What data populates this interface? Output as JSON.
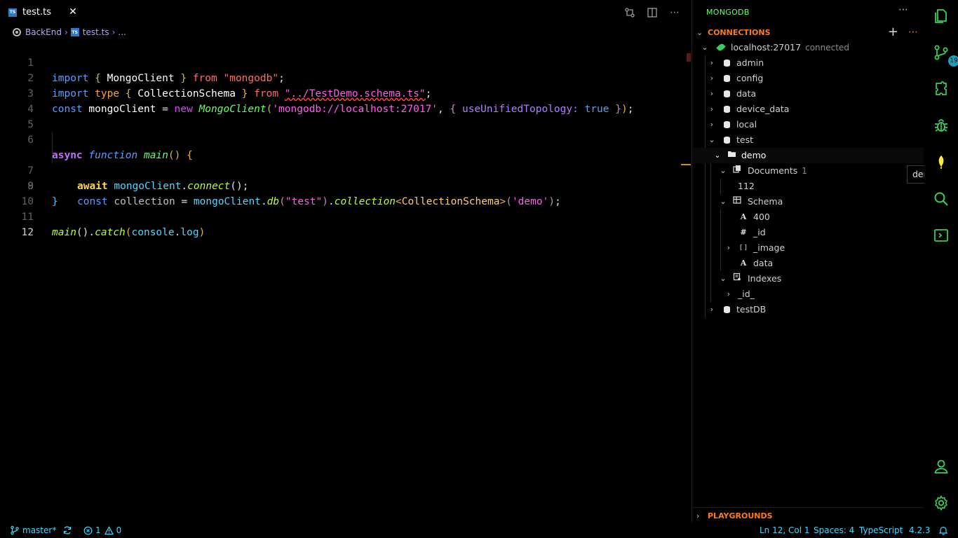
{
  "editor": {
    "tab": {
      "title": "test.ts",
      "icon": "typescript-file-icon"
    },
    "breadcrumb": {
      "folder": "BackEnd",
      "file": "test.ts",
      "more": "..."
    },
    "lines": [
      "1",
      "2",
      "3",
      "4",
      "5",
      "6",
      "7",
      "8",
      "9",
      "10",
      "11",
      "12"
    ],
    "code": {
      "l1": {
        "import": "import",
        "open": "{",
        "name": "MongoClient",
        "close": "}",
        "from": "from",
        "module": "\"mongodb\"",
        "semi": ";"
      },
      "l2": {
        "import": "import",
        "type": "type",
        "open": "{",
        "name": "CollectionSchema",
        "close": "}",
        "from": "from",
        "module": "\"../TestDemo.schema.ts\"",
        "semi": ";"
      },
      "l3": {
        "const": "const",
        "var": "mongoClient",
        "eq": "=",
        "new": "new",
        "cls": "MongoClient",
        "p1": "(",
        "url": "'mongodb://localhost:27017'",
        "comma": ",",
        "o1": "{",
        "key": "useUnifiedTopology:",
        "val": "true",
        "o2": "}",
        "p2": ")",
        "semi": ";"
      },
      "l6": {
        "async": "async",
        "function": "function",
        "name": "main",
        "paren": "()",
        "brace": "{"
      },
      "l7": {
        "await": "await",
        "obj": "mongoClient",
        "dot": ".",
        "method": "connect",
        "rest": "();"
      },
      "l8": {
        "const": "const",
        "var": "collection",
        "eq": "=",
        "obj": "mongoClient",
        "dot1": ".",
        "db": "db",
        "p1": "(",
        "arg1": "\"test\"",
        "p2": ")",
        "dot2": ".",
        "coll": "collection",
        "lt": "<",
        "type": "CollectionSchema",
        "gt": ">",
        "p3": "(",
        "arg2": "'demo'",
        "p4": ")",
        "semi": ";"
      },
      "l9": {
        "brace": "}"
      },
      "l11": {
        "name": "main",
        "p1": "()",
        "dot": ".",
        "catch": "catch",
        "p2": "(",
        "console": "console",
        "dot2": ".",
        "log": "log",
        "p3": ")"
      }
    }
  },
  "sidebar": {
    "title": "MONGODB",
    "connections_label": "CONNECTIONS",
    "playgrounds_label": "PLAYGROUNDS",
    "connection": {
      "host": "localhost:27017",
      "status": "connected"
    },
    "databases": [
      "admin",
      "config",
      "data",
      "device_data",
      "local",
      "test",
      "testDB"
    ],
    "collection": "demo",
    "documents": {
      "label": "Documents",
      "count": "1",
      "value": "112"
    },
    "schema": {
      "label": "Schema",
      "fields": [
        "400",
        "_id",
        "_image",
        "data"
      ]
    },
    "indexes": {
      "label": "Indexes",
      "items": [
        "_id_"
      ]
    },
    "tooltip": "demo"
  },
  "statusbar": {
    "branch": "master*",
    "errors": "1",
    "warnings": "0",
    "position": "Ln 12, Col 1",
    "spaces": "Spaces: 4",
    "language": "TypeScript",
    "version": "4.2.3"
  },
  "colors": {
    "accent_green": "#66ff66",
    "accent_orange": "#ff7a18",
    "status_cyan": "#3fd9ff"
  }
}
